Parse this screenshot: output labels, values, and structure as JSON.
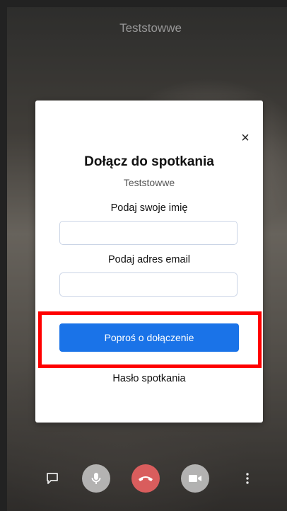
{
  "call": {
    "meeting_name": "Teststowwe"
  },
  "dialog": {
    "close_symbol": "×",
    "title": "Dołącz do spotkania",
    "meeting_name": "Teststowwe",
    "name_label": "Podaj swoje imię",
    "name_value": "",
    "email_label": "Podaj adres email",
    "email_value": "",
    "join_button": "Poproś o dołączenie",
    "password_label": "Hasło spotkania"
  },
  "toolbar": {
    "icons": [
      "chat-icon",
      "microphone-icon",
      "hang-up-icon",
      "camera-icon",
      "more-icon"
    ]
  },
  "colors": {
    "primary": "#1a73e8",
    "hangup": "#d95d5d",
    "highlight": "#ff0000"
  }
}
